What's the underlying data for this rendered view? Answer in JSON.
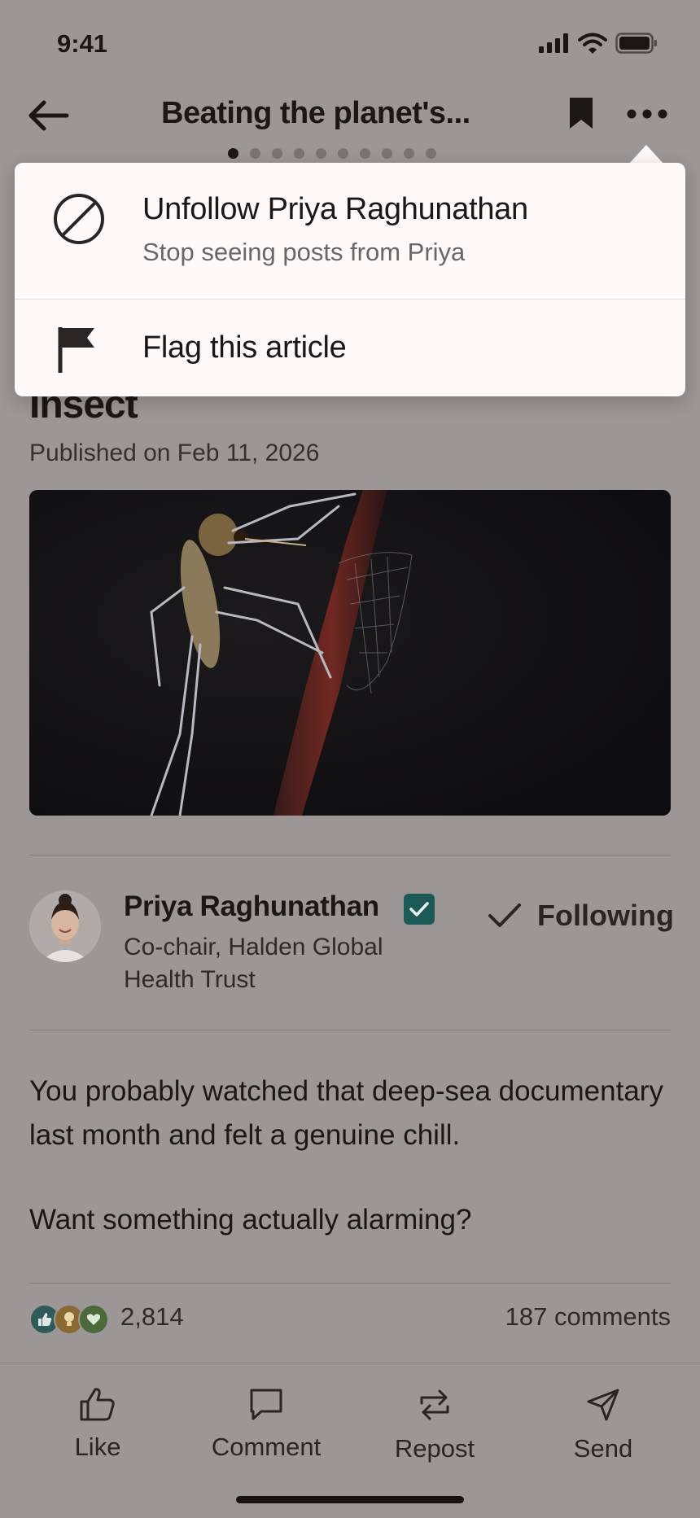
{
  "status_bar": {
    "time": "9:41"
  },
  "nav": {
    "title": "Beating the planet's...",
    "page_dots": 10,
    "active_dot": 0
  },
  "article": {
    "headline_fragment": "Insect",
    "published": "Published on Feb 11, 2026"
  },
  "author": {
    "name": "Priya Raghunathan",
    "title": "Co-chair, Halden Global Health Trust",
    "follow_label": "Following"
  },
  "body": {
    "paragraphs": [
      "You probably watched that deep-sea documentary last month and felt a genuine chill.",
      "Want something actually alarming?"
    ]
  },
  "engagement": {
    "reaction_count": "2,814",
    "comments": "187 comments"
  },
  "actions": [
    {
      "label": "Like",
      "icon": "thumbs-up-icon"
    },
    {
      "label": "Comment",
      "icon": "comment-icon"
    },
    {
      "label": "Repost",
      "icon": "repost-icon"
    },
    {
      "label": "Send",
      "icon": "send-icon"
    }
  ],
  "menu": {
    "items": [
      {
        "title": "Unfollow Priya Raghunathan",
        "subtitle": "Stop seeing posts from Priya",
        "icon": "block-icon"
      },
      {
        "title": "Flag this article",
        "icon": "flag-icon"
      }
    ]
  },
  "colors": {
    "accent": "#1c5a58",
    "menu_bg": "#fff9f9",
    "scrim": "#9c9696"
  }
}
